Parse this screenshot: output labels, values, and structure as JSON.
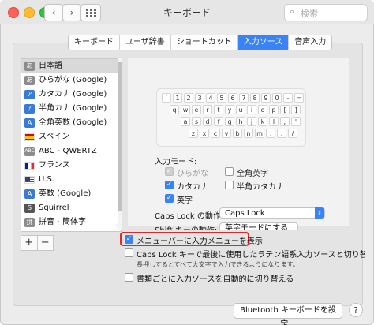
{
  "window": {
    "title": "キーボード"
  },
  "search": {
    "placeholder": "検索"
  },
  "tabs": [
    "キーボード",
    "ユーザ辞書",
    "ショートカット",
    "入力ソース",
    "音声入力"
  ],
  "sources": [
    {
      "icon_text": "あ",
      "label": "日本語"
    },
    {
      "icon_text": "あ",
      "label": "ひらがな (Google)"
    },
    {
      "icon_text": "ア",
      "label": "カタカナ (Google)"
    },
    {
      "icon_text": "ｱ",
      "label": "半角カナ (Google)"
    },
    {
      "icon_text": "A",
      "label": "全角英数 (Google)"
    },
    {
      "icon_text": "",
      "label": "スペイン"
    },
    {
      "icon_text": "ABC",
      "label": "ABC - QWERTZ"
    },
    {
      "icon_text": "",
      "label": "フランス"
    },
    {
      "icon_text": "",
      "label": "U.S."
    },
    {
      "icon_text": "A",
      "label": "英数 (Google)"
    },
    {
      "icon_text": "S",
      "label": "Squirrel"
    },
    {
      "icon_text": "拼",
      "label": "拼音 - 簡体字"
    }
  ],
  "list_buttons": {
    "add": "+",
    "remove": "−"
  },
  "keyboard_rows": [
    [
      "`",
      "1",
      "2",
      "3",
      "4",
      "5",
      "6",
      "7",
      "8",
      "9",
      "0",
      "-",
      "=",
      "⌫"
    ],
    [
      "q",
      "w",
      "e",
      "r",
      "t",
      "y",
      "u",
      "i",
      "o",
      "p",
      "[",
      "]",
      "\\"
    ],
    [
      "a",
      "s",
      "d",
      "f",
      "g",
      "h",
      "j",
      "k",
      "l",
      ";",
      "'"
    ],
    [
      "z",
      "x",
      "c",
      "v",
      "b",
      "n",
      "m",
      ",",
      ".",
      "/"
    ]
  ],
  "input_modes": {
    "title": "入力モード:",
    "items": [
      {
        "label": "ひらがな",
        "state": "disabled-checked"
      },
      {
        "label": "全角英字",
        "state": "unchecked"
      },
      {
        "label": "カタカナ",
        "state": "checked"
      },
      {
        "label": "半角カタカナ",
        "state": "unchecked"
      },
      {
        "label": "英字",
        "state": "checked"
      }
    ]
  },
  "caps_lock": {
    "label": "Caps Lock の動作:",
    "value": "Caps Lock"
  },
  "shift_key": {
    "label": "Shift キーの動作:",
    "value": "英字モードにする"
  },
  "options": {
    "menu_bar": "メニューバーに入力メニューを表示",
    "caps_switch": "Caps Lock キーで最後に使用したラテン語系入力ソースと切り替える",
    "caps_note": "長押しするとすべて大文字で入力できるようになります。",
    "auto_switch": "書類ごとに入力ソースを自動的に切り替える"
  },
  "buttons": {
    "bluetooth": "Bluetooth キーボードを設定...",
    "help": "?"
  },
  "colors": {
    "accent": "#3a82f7",
    "highlight": "#e32626"
  }
}
